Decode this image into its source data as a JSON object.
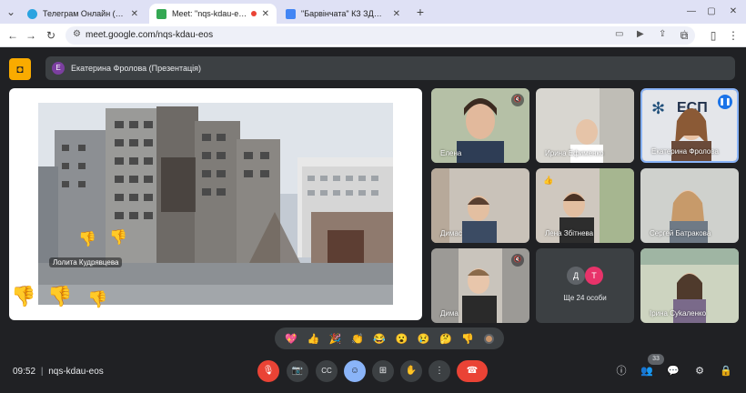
{
  "browser": {
    "tabs": [
      {
        "title": "Телеграм Онлайн (неофіційн",
        "color": "#2aa3e0"
      },
      {
        "title": "Meet: \"nqs-kdau-eos\"",
        "color": "#34a853"
      },
      {
        "title": "\"Барвінчата\" КЗ ЗДО \"Буратіно\"",
        "color": "#4285f4"
      }
    ],
    "url": "meet.google.com/nqs-kdau-eos"
  },
  "meet": {
    "presenter_initial": "Е",
    "presenter_label": "Екатерина Фролова (Презентація)",
    "pinned_name": "Лолита Кудрявцева",
    "tiles": [
      {
        "name": "Елена"
      },
      {
        "name": "Ирина Ефименко"
      },
      {
        "name": "Екатерина Фролова"
      },
      {
        "name": "Димас"
      },
      {
        "name": "Лена Збітнева"
      },
      {
        "name": "Сергей Батракова"
      },
      {
        "name": "Дима"
      },
      {
        "name": "Ірина Суkаленко"
      }
    ],
    "more": {
      "initials": [
        "Д",
        "Т"
      ],
      "label": "Ще 24 особи"
    },
    "reactions": [
      "💖",
      "👍",
      "🎉",
      "👏",
      "😂",
      "😮",
      "😢",
      "🤔",
      "👎"
    ],
    "time": "09:52",
    "code": "nqs-kdau-eos",
    "participants_count": "33"
  }
}
